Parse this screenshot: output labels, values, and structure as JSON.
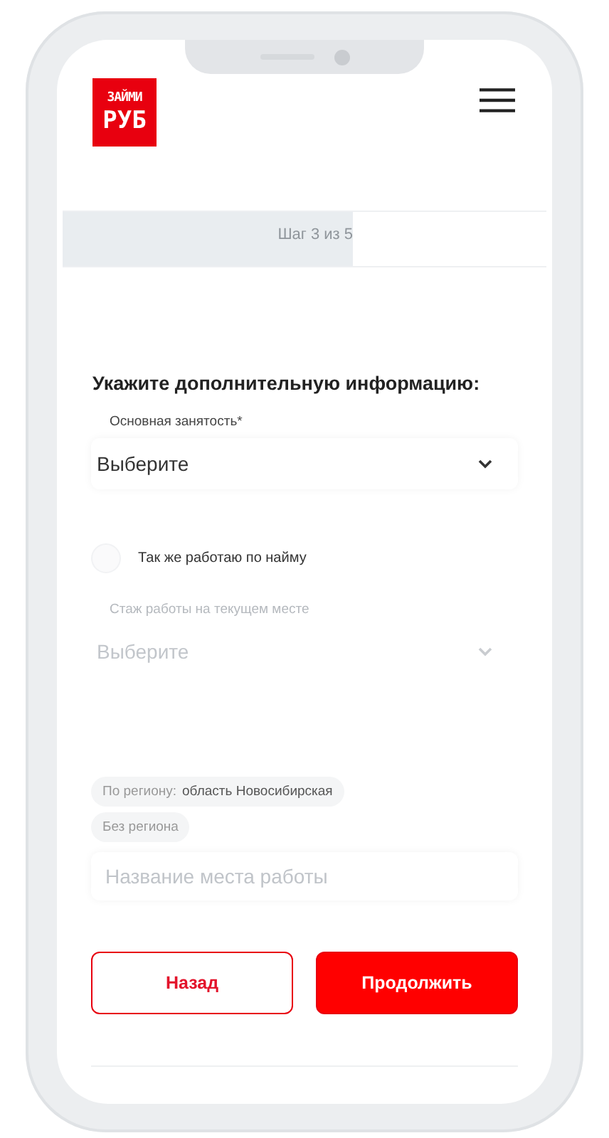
{
  "logo": {
    "line_1": "ЗАЙМИ",
    "line_2": "РУБ"
  },
  "progress": {
    "label": "Шаг 3 из 5",
    "level": 0.6
  },
  "form": {
    "heading": "Укажите дополнительную информацию:",
    "fields": [
      {
        "kind": "select",
        "label": "Основная занятость*",
        "value": "Выберите",
        "disabled": false
      },
      {
        "kind": "checkbox",
        "label": "Так же работаю по найму",
        "checked": false
      },
      {
        "kind": "select",
        "label": "Стаж работы на текущем месте",
        "value": "Выберите",
        "disabled": true
      }
    ],
    "chips": [
      {
        "label": "По региону:",
        "value": "область Новосибирская"
      },
      {
        "label": "Без региона"
      }
    ],
    "workplace": {
      "placeholder": "Название места работы"
    }
  },
  "buttons": [
    {
      "kind": "outline",
      "label": "Назад"
    },
    {
      "kind": "primary",
      "label": "Продолжить"
    }
  ]
}
